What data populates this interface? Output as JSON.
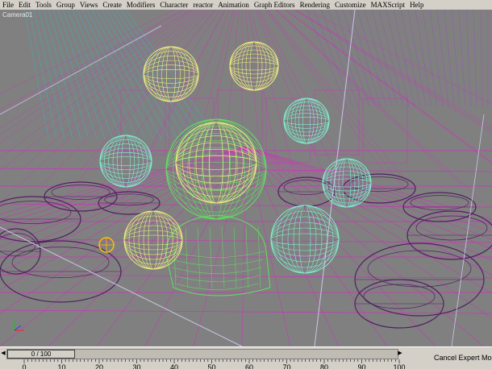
{
  "menubar": {
    "items": [
      "File",
      "Edit",
      "Tools",
      "Group",
      "Views",
      "Create",
      "Modifiers",
      "Character",
      "reactor",
      "Animation",
      "Graph Editors",
      "Rendering",
      "Customize",
      "MAXScript",
      "Help"
    ]
  },
  "viewport": {
    "label": "Camera01",
    "background": "#808080",
    "wire_colors": {
      "magenta": "#e020c8",
      "purple": "#a040d0",
      "cyan": "#20c0e0",
      "green": "#60e060",
      "sphere_a": "#f0f080",
      "sphere_b": "#80f0d0",
      "dark_purple": "#502060",
      "yellow": "#ffc000"
    },
    "icons": [
      "axis-gizmo-icon",
      "camera-target-icon"
    ]
  },
  "timeline": {
    "frame_display": "0 / 100",
    "ticks": [
      "0",
      "10",
      "20",
      "30",
      "40",
      "50",
      "60",
      "70",
      "80",
      "90",
      "100"
    ]
  },
  "status": {
    "text": "Cancel Expert Mode"
  }
}
